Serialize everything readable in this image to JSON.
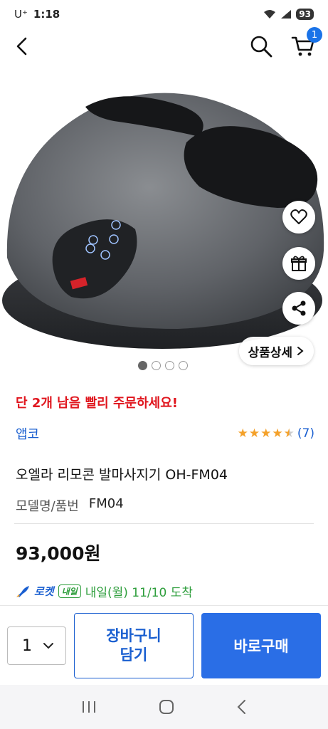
{
  "status_bar": {
    "carrier": "U⁺",
    "time": "1:18",
    "battery": "93"
  },
  "nav": {
    "cart_count": "1"
  },
  "gallery": {
    "detail_label": "상품상세",
    "page_count": 4,
    "active_page": 1
  },
  "product": {
    "urgency": "단 2개 남음 빨리 주문하세요!",
    "seller": "앱코",
    "rating": 4.5,
    "review_count": "(7)",
    "title": "오엘라 리모콘 발마사지기 OH-FM04",
    "model_label": "모델명/품번",
    "model_value": "FM04",
    "price": "93,000원",
    "delivery": {
      "rocket_label": "로켓",
      "tomorrow_badge": "내일",
      "text": "내일(월) 11/10 도착"
    }
  },
  "buy_bar": {
    "quantity": "1",
    "cart_label_line1": "장바구니",
    "cart_label_line2": "담기",
    "buy_label": "바로구매"
  },
  "colors": {
    "accent": "#1a5fd0",
    "urgent": "#e0161e",
    "delivery": "#2e9e3c",
    "star": "#f4a12a"
  }
}
